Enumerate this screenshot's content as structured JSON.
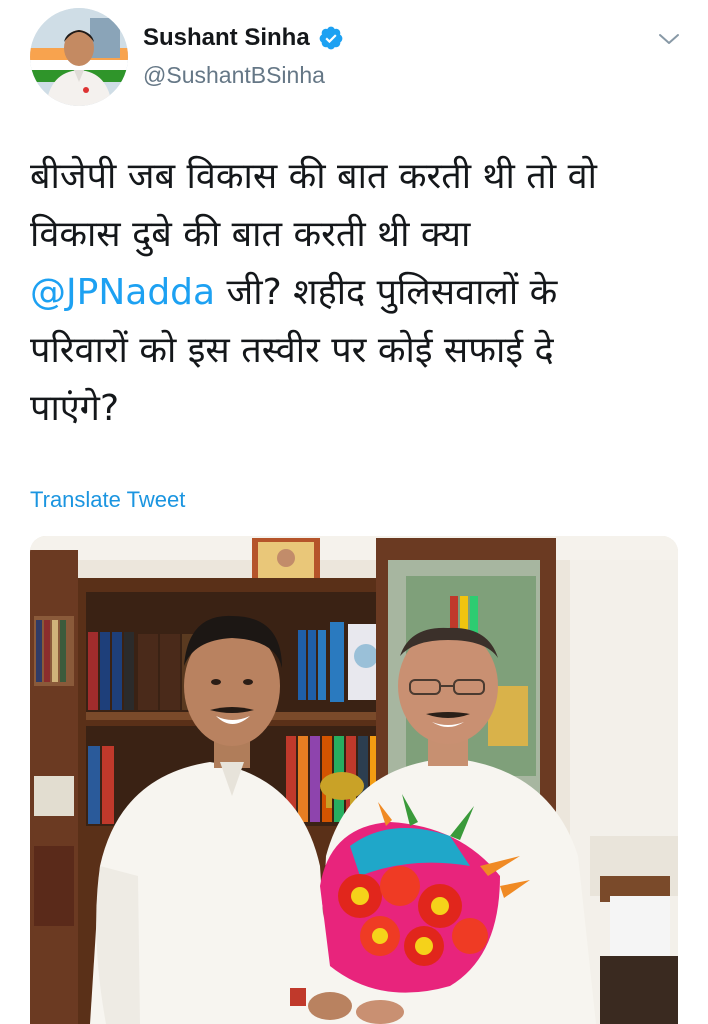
{
  "author": {
    "display_name": "Sushant Sinha",
    "handle": "@SushantBSinha",
    "verified": true
  },
  "tweet": {
    "line1": "बीजेपी जब विकास की बात करती थी तो वो",
    "line2": "विकास दुबे की बात करती थी क्या",
    "mention": "@JPNadda",
    "line3_rest": " जी? शहीद पुलिसवालों के",
    "line4": "परिवारों को इस तस्वीर पर कोई सफाई दे",
    "line5": "पाएंगे?"
  },
  "actions": {
    "translate_label": "Translate Tweet"
  },
  "icons": {
    "verified": "verified-badge-icon",
    "menu": "chevron-down-icon"
  },
  "colors": {
    "link": "#1da1f2",
    "verified": "#1da1f2",
    "secondary_text": "#657786"
  }
}
